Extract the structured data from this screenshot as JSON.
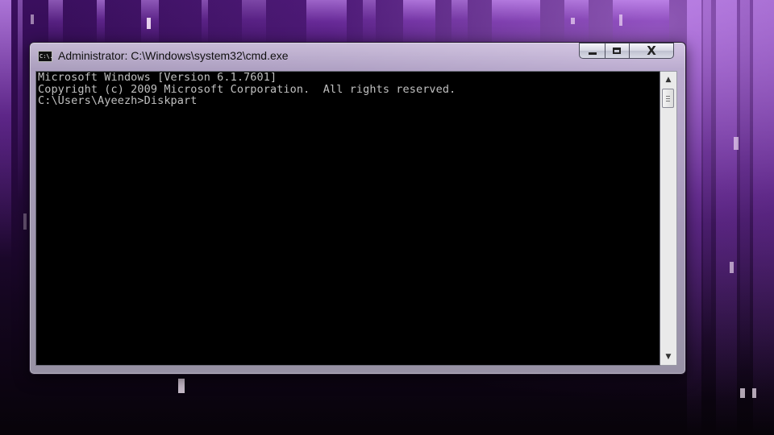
{
  "window": {
    "title": "Administrator: C:\\Windows\\system32\\cmd.exe",
    "icon": "cmd-icon",
    "icon_text": "C:\\."
  },
  "caption_buttons": {
    "minimize_icon": "minimize-icon",
    "maximize_icon": "maximize-icon",
    "close_label": "X"
  },
  "console": {
    "lines": [
      "Microsoft Windows [Version 6.1.7601]",
      "Copyright (c) 2009 Microsoft Corporation.  All rights reserved.",
      "",
      "C:\\Users\\Ayeezh>Diskpart"
    ],
    "text_color": "#c0c0c0",
    "background": "#000000"
  },
  "scrollbar": {
    "up_arrow": "▲",
    "down_arrow": "▼"
  },
  "colors": {
    "desktop_accent": "#8a3dc7",
    "desktop_dark": "#14061f"
  }
}
